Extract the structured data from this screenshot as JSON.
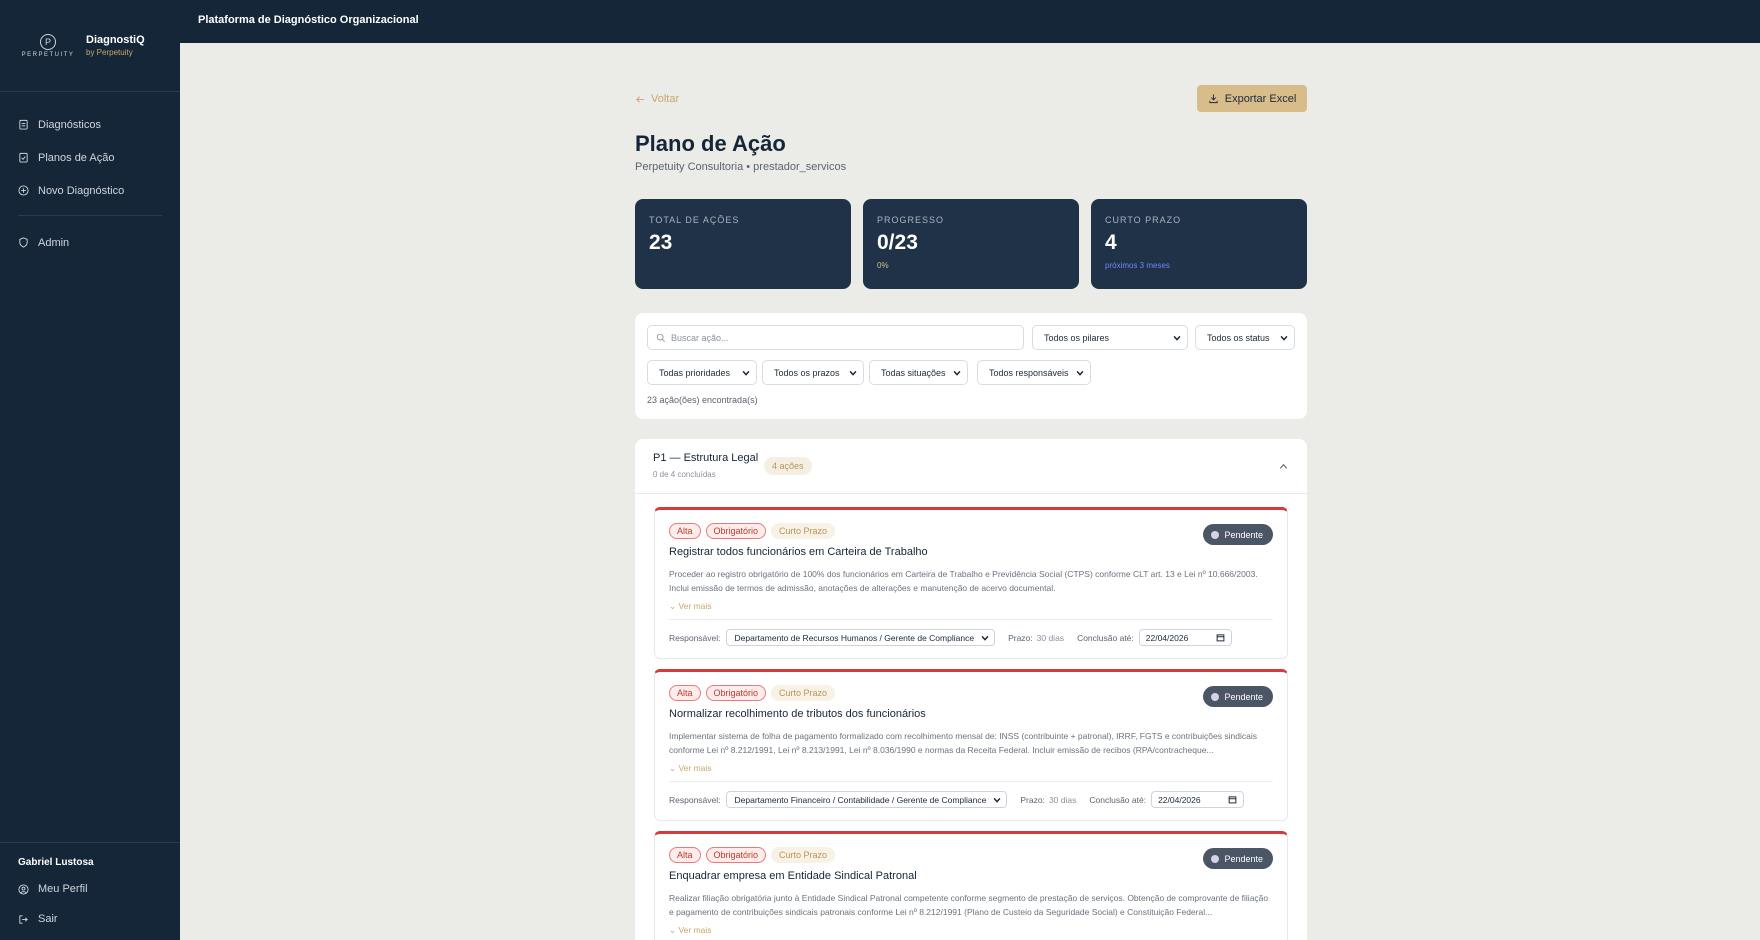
{
  "sidebar": {
    "logo_text": "PERPETUITY",
    "brand_title": "DiagnostiQ",
    "brand_sub": "by Perpetuity",
    "items": [
      {
        "label": "Diagnósticos",
        "icon": "clipboard-icon"
      },
      {
        "label": "Planos de Ação",
        "icon": "clipboard-check-icon"
      },
      {
        "label": "Novo Diagnóstico",
        "icon": "plus-circle-icon"
      },
      {
        "label": "Admin",
        "icon": "shield-icon"
      }
    ],
    "user_name": "Gabriel Lustosa",
    "profile_label": "Meu Perfil",
    "logout_label": "Sair"
  },
  "topbar": {
    "title": "Plataforma de Diagnóstico Organizacional"
  },
  "header": {
    "back_label": "Voltar",
    "export_label": "Exportar Excel",
    "title": "Plano de Ação",
    "subtitle": "Perpetuity Consultoria • prestador_servicos"
  },
  "stats": [
    {
      "label": "TOTAL DE AÇÕES",
      "value": "23",
      "note": ""
    },
    {
      "label": "PROGRESSO",
      "value": "0/23",
      "note": "0%",
      "note_color": "#d8bd8b"
    },
    {
      "label": "CURTO PRAZO",
      "value": "4",
      "note": "próximos 3 meses",
      "note_color": "#6f86ff"
    }
  ],
  "filters": {
    "search_placeholder": "Buscar ação...",
    "pilares": "Todos os pilares",
    "status": "Todos os status",
    "prioridades": "Todas prioridades",
    "prazos": "Todos os prazos",
    "situacoes": "Todas situações",
    "responsaveis": "Todos responsáveis",
    "found": "23 ação(ões) encontrada(s)"
  },
  "group": {
    "title": "P1 — Estrutura Legal",
    "sub": "0 de 4 concluídas",
    "badge": "4 ações"
  },
  "labels": {
    "responsavel": "Responsável:",
    "prazo": "Prazo:",
    "conclusao": "Conclusão até:",
    "ver_mais": "Ver mais"
  },
  "cards": [
    {
      "tags": [
        "Alta",
        "Obrigatório",
        "Curto Prazo"
      ],
      "status": "Pendente",
      "title": "Registrar todos funcionários em Carteira de Trabalho",
      "desc": "Proceder ao registro obrigatório de 100% dos funcionários em Carteira de Trabalho e Previdência Social (CTPS) conforme CLT art. 13 e Lei nº 10.666/2003. Inclui emissão de termos de admissão, anotações de alterações e manutenção de acervo documental.",
      "responsavel": "Departamento de Recursos Humanos / Gerente de Compliance",
      "prazo": "30 dias",
      "conclusao": "22/04/2026"
    },
    {
      "tags": [
        "Alta",
        "Obrigatório",
        "Curto Prazo"
      ],
      "status": "Pendente",
      "title": "Normalizar recolhimento de tributos dos funcionários",
      "desc": "Implementar sistema de folha de pagamento formalizado com recolhimento mensal de: INSS (contribuinte + patronal), IRRF, FGTS e contribuições sindicais conforme Lei nº 8.212/1991, Lei nº 8.213/1991, Lei nº 8.036/1990 e normas da Receita Federal. Incluir emissão de recibos (RPA/contracheque...",
      "responsavel": "Departamento Financeiro / Contabilidade / Gerente de Compliance",
      "prazo": "30 dias",
      "conclusao": "22/04/2026"
    },
    {
      "tags": [
        "Alta",
        "Obrigatório",
        "Curto Prazo"
      ],
      "status": "Pendente",
      "title": "Enquadrar empresa em Entidade Sindical Patronal",
      "desc": "Realizar filiação obrigatória junto à Entidade Sindical Patronal competente conforme segmento de prestação de serviços. Obtenção de comprovante de filiação e pagamento de contribuições sindicais patronais conforme Lei nº 8.212/1991 (Plano de Custeio da Seguridade Social) e Constituição Federal...",
      "responsavel": "",
      "prazo": "",
      "conclusao": ""
    }
  ]
}
